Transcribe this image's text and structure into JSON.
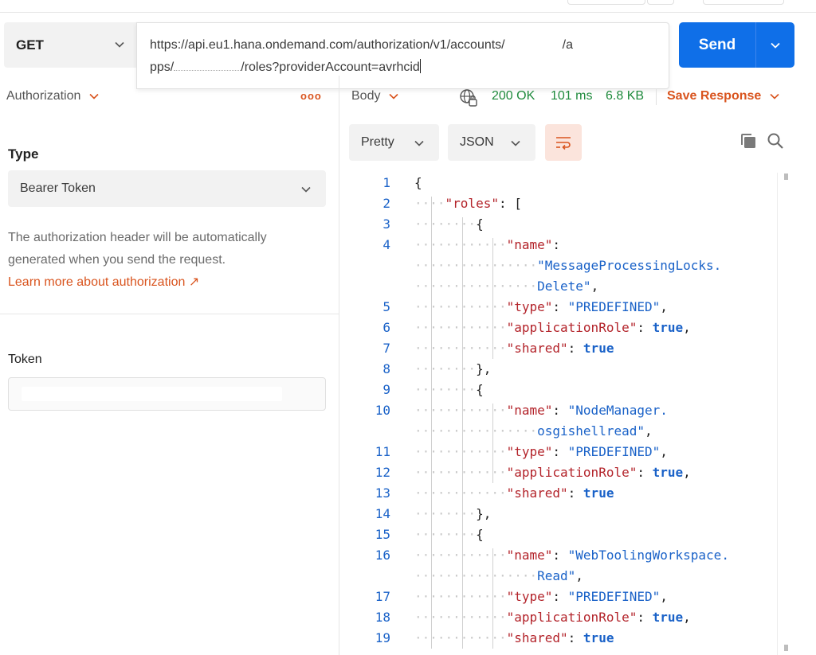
{
  "request": {
    "method": "GET",
    "url_part1": "https://api.eu1.hana.ondemand.com/authorization/v1/accounts/",
    "url_part1_end": "/a",
    "url_part2_start": "pps/",
    "url_part2_end": "/roles?providerAccount=avrhcid",
    "send_label": "Send"
  },
  "auth": {
    "tab_label": "Authorization",
    "more": "ooo",
    "type_label": "Type",
    "type_value": "Bearer Token",
    "description": "The authorization header will be automatically generated when you send the request.",
    "learn_more": "Learn more about authorization ↗",
    "token_label": "Token"
  },
  "response": {
    "body_tab": "Body",
    "status": "200 OK",
    "time": "101 ms",
    "size": "6.8 KB",
    "save_response": "Save Response",
    "format": "Pretty",
    "language": "JSON"
  },
  "code_lines": [
    {
      "n": "1",
      "indent": 0,
      "parts": [
        {
          "t": "{",
          "c": "p"
        }
      ]
    },
    {
      "n": "2",
      "indent": 1,
      "parts": [
        {
          "t": "\"roles\"",
          "c": "key"
        },
        {
          "t": ": [",
          "c": "p"
        }
      ]
    },
    {
      "n": "3",
      "indent": 2,
      "parts": [
        {
          "t": "{",
          "c": "p"
        }
      ]
    },
    {
      "n": "4",
      "indent": 3,
      "parts": [
        {
          "t": "\"name\"",
          "c": "key"
        },
        {
          "t": ":",
          "c": "p"
        }
      ]
    },
    {
      "n": "",
      "indent": 4,
      "parts": [
        {
          "t": "\"MessageProcessingLocks.",
          "c": "str"
        }
      ]
    },
    {
      "n": "",
      "indent": 4,
      "parts": [
        {
          "t": "Delete\"",
          "c": "str"
        },
        {
          "t": ",",
          "c": "p"
        }
      ]
    },
    {
      "n": "5",
      "indent": 3,
      "parts": [
        {
          "t": "\"type\"",
          "c": "key"
        },
        {
          "t": ": ",
          "c": "p"
        },
        {
          "t": "\"PREDEFINED\"",
          "c": "str"
        },
        {
          "t": ",",
          "c": "p"
        }
      ]
    },
    {
      "n": "6",
      "indent": 3,
      "parts": [
        {
          "t": "\"applicationRole\"",
          "c": "key"
        },
        {
          "t": ": ",
          "c": "p"
        },
        {
          "t": "true",
          "c": "bool"
        },
        {
          "t": ",",
          "c": "p"
        }
      ]
    },
    {
      "n": "7",
      "indent": 3,
      "parts": [
        {
          "t": "\"shared\"",
          "c": "key"
        },
        {
          "t": ": ",
          "c": "p"
        },
        {
          "t": "true",
          "c": "bool"
        }
      ]
    },
    {
      "n": "8",
      "indent": 2,
      "parts": [
        {
          "t": "},",
          "c": "p"
        }
      ]
    },
    {
      "n": "9",
      "indent": 2,
      "parts": [
        {
          "t": "{",
          "c": "p"
        }
      ]
    },
    {
      "n": "10",
      "indent": 3,
      "parts": [
        {
          "t": "\"name\"",
          "c": "key"
        },
        {
          "t": ": ",
          "c": "p"
        },
        {
          "t": "\"NodeManager.",
          "c": "str"
        }
      ]
    },
    {
      "n": "",
      "indent": 4,
      "parts": [
        {
          "t": "osgishellread\"",
          "c": "str"
        },
        {
          "t": ",",
          "c": "p"
        }
      ]
    },
    {
      "n": "11",
      "indent": 3,
      "parts": [
        {
          "t": "\"type\"",
          "c": "key"
        },
        {
          "t": ": ",
          "c": "p"
        },
        {
          "t": "\"PREDEFINED\"",
          "c": "str"
        },
        {
          "t": ",",
          "c": "p"
        }
      ]
    },
    {
      "n": "12",
      "indent": 3,
      "parts": [
        {
          "t": "\"applicationRole\"",
          "c": "key"
        },
        {
          "t": ": ",
          "c": "p"
        },
        {
          "t": "true",
          "c": "bool"
        },
        {
          "t": ",",
          "c": "p"
        }
      ]
    },
    {
      "n": "13",
      "indent": 3,
      "parts": [
        {
          "t": "\"shared\"",
          "c": "key"
        },
        {
          "t": ": ",
          "c": "p"
        },
        {
          "t": "true",
          "c": "bool"
        }
      ]
    },
    {
      "n": "14",
      "indent": 2,
      "parts": [
        {
          "t": "},",
          "c": "p"
        }
      ]
    },
    {
      "n": "15",
      "indent": 2,
      "parts": [
        {
          "t": "{",
          "c": "p"
        }
      ]
    },
    {
      "n": "16",
      "indent": 3,
      "parts": [
        {
          "t": "\"name\"",
          "c": "key"
        },
        {
          "t": ": ",
          "c": "p"
        },
        {
          "t": "\"WebToolingWorkspace.",
          "c": "str"
        }
      ]
    },
    {
      "n": "",
      "indent": 4,
      "parts": [
        {
          "t": "Read\"",
          "c": "str"
        },
        {
          "t": ",",
          "c": "p"
        }
      ]
    },
    {
      "n": "17",
      "indent": 3,
      "parts": [
        {
          "t": "\"type\"",
          "c": "key"
        },
        {
          "t": ": ",
          "c": "p"
        },
        {
          "t": "\"PREDEFINED\"",
          "c": "str"
        },
        {
          "t": ",",
          "c": "p"
        }
      ]
    },
    {
      "n": "18",
      "indent": 3,
      "parts": [
        {
          "t": "\"applicationRole\"",
          "c": "key"
        },
        {
          "t": ": ",
          "c": "p"
        },
        {
          "t": "true",
          "c": "bool"
        },
        {
          "t": ",",
          "c": "p"
        }
      ]
    },
    {
      "n": "19",
      "indent": 3,
      "parts": [
        {
          "t": "\"shared\"",
          "c": "key"
        },
        {
          "t": ": ",
          "c": "p"
        },
        {
          "t": "true",
          "c": "bool"
        }
      ]
    }
  ],
  "colors": {
    "accent": "#0f6fe8",
    "orange": "#d9541e",
    "success": "#1e8a3c",
    "json_key": "#b3232a",
    "json_value": "#1a62c8"
  }
}
